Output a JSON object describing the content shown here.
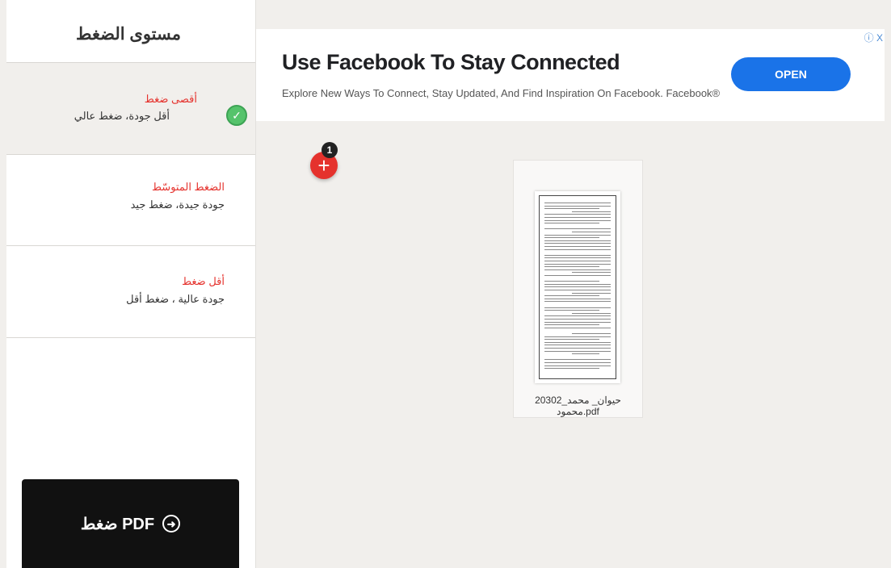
{
  "sidebar": {
    "title": "مستوى الضغط",
    "options": [
      {
        "name": "أقصى ضغط",
        "desc": "أقل جودة، ضغط عالي",
        "selected": true
      },
      {
        "name": "الضغط المتوسّط",
        "desc": "جودة جيدة، ضغط جيد",
        "selected": false
      },
      {
        "name": "أقل ضغط",
        "desc": "جودة عالية ، ضغط أقل",
        "selected": false
      }
    ],
    "compress_button": "ضغط PDF"
  },
  "ad": {
    "title": "Use Facebook To Stay Connected",
    "subtitle": "Explore New Ways To Connect, Stay Updated, And Find Inspiration On Facebook. Facebook®",
    "open_label": "OPEN",
    "close_label": "ⓘ X"
  },
  "files": {
    "count_badge": "1",
    "add_icon": "+",
    "items": [
      {
        "name": "20302_حيوان_ محمد محمود.pdf"
      }
    ]
  },
  "colors": {
    "accent_red": "#e5322d",
    "check_green": "#55c36b",
    "ad_blue": "#1a73e8"
  }
}
